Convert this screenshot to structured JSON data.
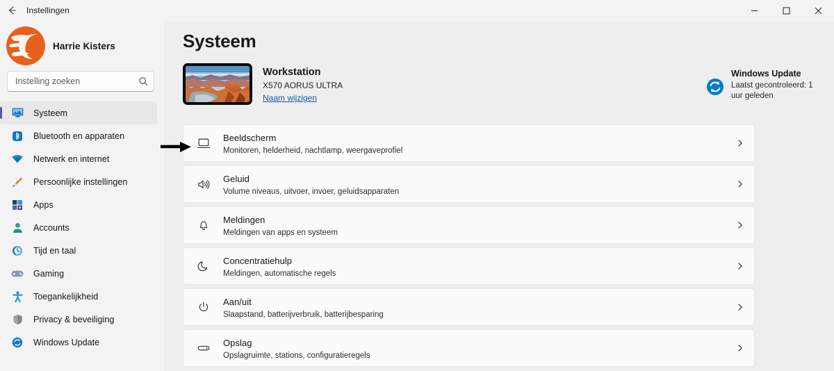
{
  "window": {
    "title": "Instellingen",
    "back_icon": "back-arrow-icon",
    "minimize_label": "Minimaliseren",
    "maximize_label": "Maximaliseren",
    "close_label": "Sluiten"
  },
  "sidebar": {
    "profile": {
      "name": "Harrie Kisters",
      "avatar_icon": "user-avatar-logo"
    },
    "search": {
      "placeholder": "Instelling zoeken",
      "value": "",
      "icon": "search-icon"
    },
    "items": [
      {
        "label": "Systeem",
        "icon": "system-monitor-icon",
        "active": true
      },
      {
        "label": "Bluetooth en apparaten",
        "icon": "bluetooth-icon",
        "active": false
      },
      {
        "label": "Netwerk en internet",
        "icon": "wifi-icon",
        "active": false
      },
      {
        "label": "Persoonlijke instellingen",
        "icon": "brush-icon",
        "active": false
      },
      {
        "label": "Apps",
        "icon": "apps-grid-icon",
        "active": false
      },
      {
        "label": "Accounts",
        "icon": "account-person-icon",
        "active": false
      },
      {
        "label": "Tijd en taal",
        "icon": "clock-globe-icon",
        "active": false
      },
      {
        "label": "Gaming",
        "icon": "gamepad-icon",
        "active": false
      },
      {
        "label": "Toegankelijkheid",
        "icon": "accessibility-icon",
        "active": false
      },
      {
        "label": "Privacy & beveiliging",
        "icon": "shield-icon",
        "active": false
      },
      {
        "label": "Windows Update",
        "icon": "windows-update-icon",
        "active": false
      }
    ]
  },
  "main": {
    "page_title": "Systeem",
    "device": {
      "name": "Workstation",
      "model": "X570 AORUS ULTRA",
      "rename_link": "Naam wijzigen",
      "thumbnail_icon": "monitor-wallpaper-thumbnail"
    },
    "windows_update": {
      "title": "Windows Update",
      "status": "Laatst gecontroleerd: 1 uur geleden",
      "icon": "windows-update-icon"
    },
    "settings": [
      {
        "title": "Beeldscherm",
        "subtitle": "Monitoren, helderheid, nachtlamp, weergaveprofiel",
        "icon": "display-monitor-icon",
        "chevron": "chevron-right-icon",
        "annotated": true
      },
      {
        "title": "Geluid",
        "subtitle": "Volume niveaus, uitvoer, invoer, geluidsapparaten",
        "icon": "speaker-icon",
        "chevron": "chevron-right-icon",
        "annotated": false
      },
      {
        "title": "Meldingen",
        "subtitle": "Meldingen van apps en systeem",
        "icon": "bell-icon",
        "chevron": "chevron-right-icon",
        "annotated": false
      },
      {
        "title": "Concentratiehulp",
        "subtitle": "Meldingen, automatische regels",
        "icon": "moon-icon",
        "chevron": "chevron-right-icon",
        "annotated": false
      },
      {
        "title": "Aan/uit",
        "subtitle": "Slaapstand, batterijverbruik, batterijbesparing",
        "icon": "power-icon",
        "chevron": "chevron-right-icon",
        "annotated": false
      },
      {
        "title": "Opslag",
        "subtitle": "Opslagruimte, stations, configuratieregels",
        "icon": "storage-drive-icon",
        "chevron": "chevron-right-icon",
        "annotated": false
      }
    ]
  },
  "annotation": {
    "arrow_icon": "pointer-arrow-annotation",
    "points_at": "Beeldscherm"
  },
  "colors": {
    "window_bg": "#eeeeee",
    "sidebar_bg": "#f3f3f3",
    "card_bg": "#fbfbfb",
    "accent_selection": "#6b4ea8",
    "link": "#1b56a4",
    "logo_orange": "#e8601c",
    "update_blue": "#0a7bc4"
  }
}
